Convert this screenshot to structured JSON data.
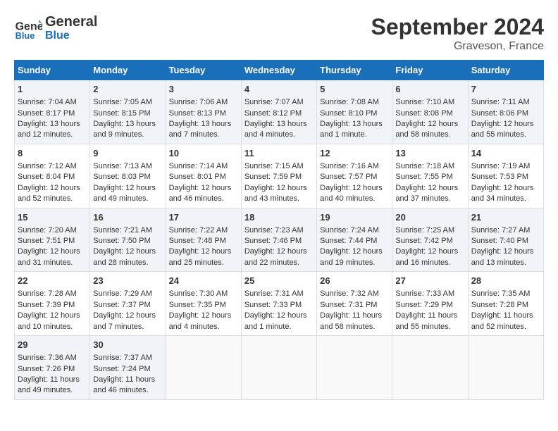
{
  "header": {
    "logo_line1": "General",
    "logo_line2": "Blue",
    "month_title": "September 2024",
    "location": "Graveson, France"
  },
  "days_of_week": [
    "Sunday",
    "Monday",
    "Tuesday",
    "Wednesday",
    "Thursday",
    "Friday",
    "Saturday"
  ],
  "weeks": [
    [
      {
        "day": "1",
        "sunrise": "7:04 AM",
        "sunset": "8:17 PM",
        "daylight": "13 hours and 12 minutes."
      },
      {
        "day": "2",
        "sunrise": "7:05 AM",
        "sunset": "8:15 PM",
        "daylight": "13 hours and 9 minutes."
      },
      {
        "day": "3",
        "sunrise": "7:06 AM",
        "sunset": "8:13 PM",
        "daylight": "13 hours and 7 minutes."
      },
      {
        "day": "4",
        "sunrise": "7:07 AM",
        "sunset": "8:12 PM",
        "daylight": "13 hours and 4 minutes."
      },
      {
        "day": "5",
        "sunrise": "7:08 AM",
        "sunset": "8:10 PM",
        "daylight": "13 hours and 1 minute."
      },
      {
        "day": "6",
        "sunrise": "7:10 AM",
        "sunset": "8:08 PM",
        "daylight": "12 hours and 58 minutes."
      },
      {
        "day": "7",
        "sunrise": "7:11 AM",
        "sunset": "8:06 PM",
        "daylight": "12 hours and 55 minutes."
      }
    ],
    [
      {
        "day": "8",
        "sunrise": "7:12 AM",
        "sunset": "8:04 PM",
        "daylight": "12 hours and 52 minutes."
      },
      {
        "day": "9",
        "sunrise": "7:13 AM",
        "sunset": "8:03 PM",
        "daylight": "12 hours and 49 minutes."
      },
      {
        "day": "10",
        "sunrise": "7:14 AM",
        "sunset": "8:01 PM",
        "daylight": "12 hours and 46 minutes."
      },
      {
        "day": "11",
        "sunrise": "7:15 AM",
        "sunset": "7:59 PM",
        "daylight": "12 hours and 43 minutes."
      },
      {
        "day": "12",
        "sunrise": "7:16 AM",
        "sunset": "7:57 PM",
        "daylight": "12 hours and 40 minutes."
      },
      {
        "day": "13",
        "sunrise": "7:18 AM",
        "sunset": "7:55 PM",
        "daylight": "12 hours and 37 minutes."
      },
      {
        "day": "14",
        "sunrise": "7:19 AM",
        "sunset": "7:53 PM",
        "daylight": "12 hours and 34 minutes."
      }
    ],
    [
      {
        "day": "15",
        "sunrise": "7:20 AM",
        "sunset": "7:51 PM",
        "daylight": "12 hours and 31 minutes."
      },
      {
        "day": "16",
        "sunrise": "7:21 AM",
        "sunset": "7:50 PM",
        "daylight": "12 hours and 28 minutes."
      },
      {
        "day": "17",
        "sunrise": "7:22 AM",
        "sunset": "7:48 PM",
        "daylight": "12 hours and 25 minutes."
      },
      {
        "day": "18",
        "sunrise": "7:23 AM",
        "sunset": "7:46 PM",
        "daylight": "12 hours and 22 minutes."
      },
      {
        "day": "19",
        "sunrise": "7:24 AM",
        "sunset": "7:44 PM",
        "daylight": "12 hours and 19 minutes."
      },
      {
        "day": "20",
        "sunrise": "7:25 AM",
        "sunset": "7:42 PM",
        "daylight": "12 hours and 16 minutes."
      },
      {
        "day": "21",
        "sunrise": "7:27 AM",
        "sunset": "7:40 PM",
        "daylight": "12 hours and 13 minutes."
      }
    ],
    [
      {
        "day": "22",
        "sunrise": "7:28 AM",
        "sunset": "7:39 PM",
        "daylight": "12 hours and 10 minutes."
      },
      {
        "day": "23",
        "sunrise": "7:29 AM",
        "sunset": "7:37 PM",
        "daylight": "12 hours and 7 minutes."
      },
      {
        "day": "24",
        "sunrise": "7:30 AM",
        "sunset": "7:35 PM",
        "daylight": "12 hours and 4 minutes."
      },
      {
        "day": "25",
        "sunrise": "7:31 AM",
        "sunset": "7:33 PM",
        "daylight": "12 hours and 1 minute."
      },
      {
        "day": "26",
        "sunrise": "7:32 AM",
        "sunset": "7:31 PM",
        "daylight": "11 hours and 58 minutes."
      },
      {
        "day": "27",
        "sunrise": "7:33 AM",
        "sunset": "7:29 PM",
        "daylight": "11 hours and 55 minutes."
      },
      {
        "day": "28",
        "sunrise": "7:35 AM",
        "sunset": "7:28 PM",
        "daylight": "11 hours and 52 minutes."
      }
    ],
    [
      {
        "day": "29",
        "sunrise": "7:36 AM",
        "sunset": "7:26 PM",
        "daylight": "11 hours and 49 minutes."
      },
      {
        "day": "30",
        "sunrise": "7:37 AM",
        "sunset": "7:24 PM",
        "daylight": "11 hours and 46 minutes."
      },
      null,
      null,
      null,
      null,
      null
    ]
  ]
}
